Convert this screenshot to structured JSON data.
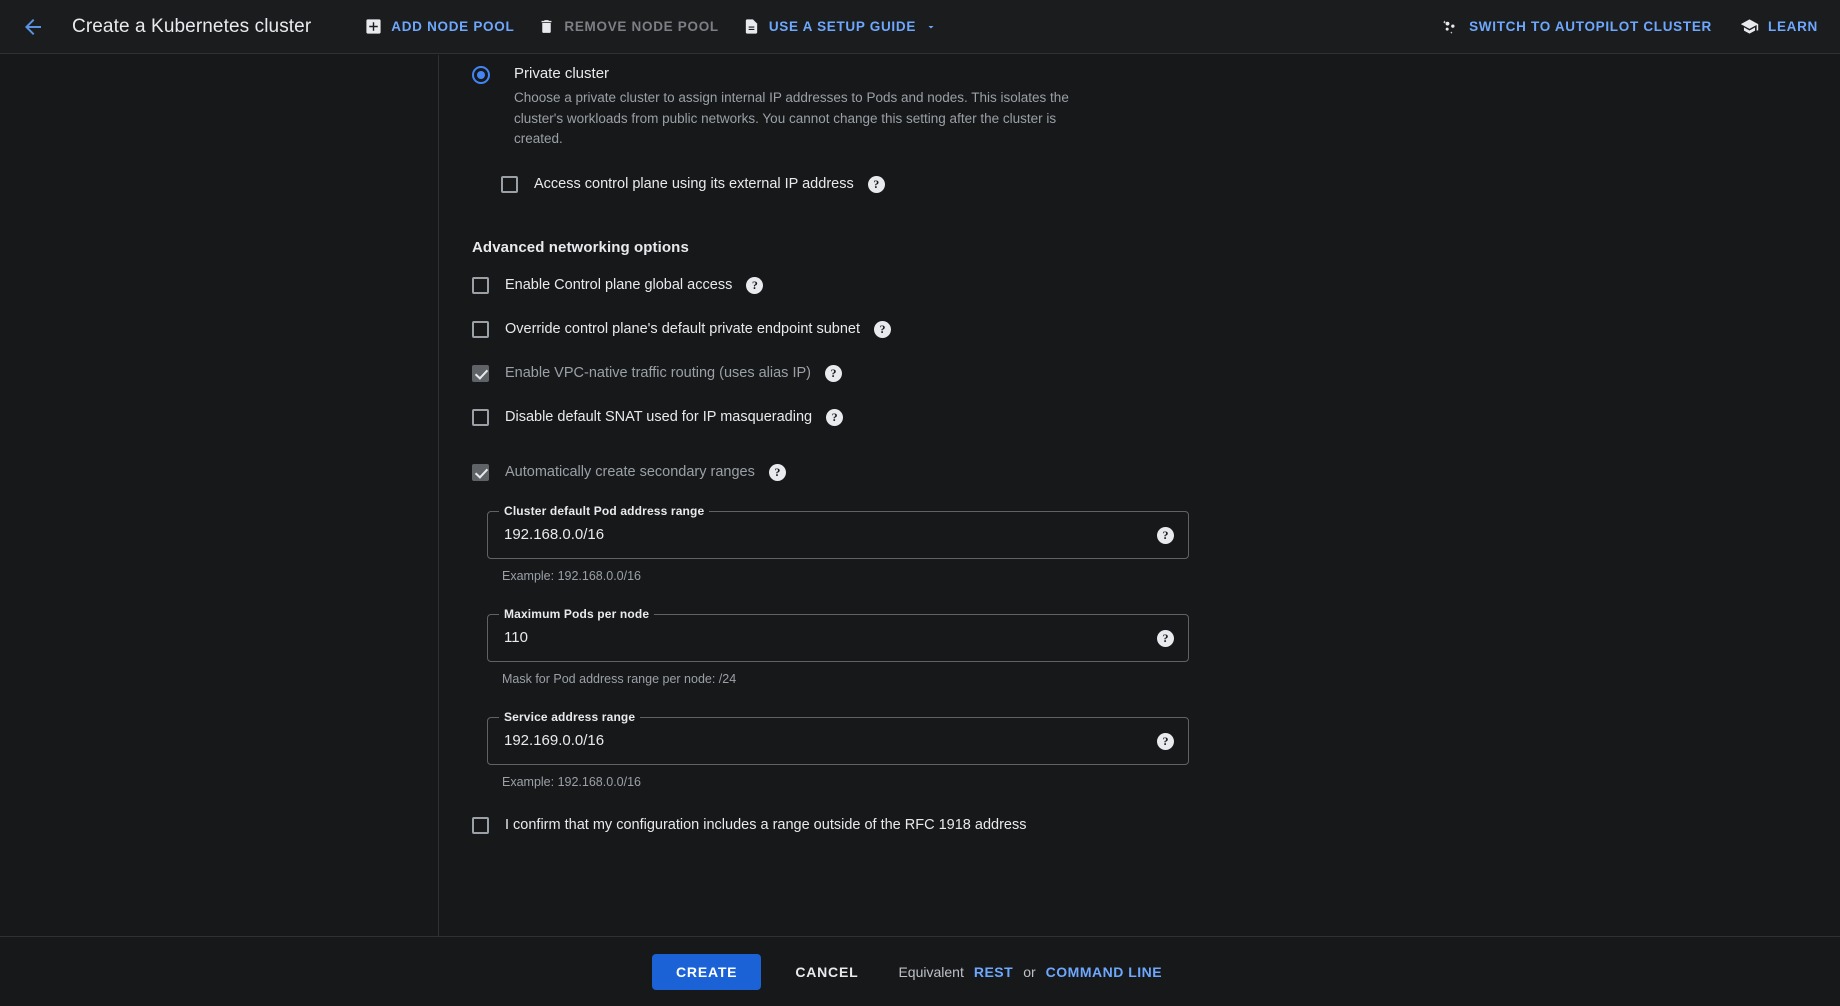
{
  "header": {
    "back_icon": "arrow-left-icon",
    "title": "Create a Kubernetes cluster",
    "actions": [
      {
        "id": "add-node-pool",
        "icon": "plus-box-icon",
        "label": "ADD NODE POOL",
        "enabled": true
      },
      {
        "id": "remove-node-pool",
        "icon": "trash-icon",
        "label": "REMOVE NODE POOL",
        "enabled": false
      },
      {
        "id": "use-a-setup-guide",
        "icon": "document-icon",
        "label": "USE A SETUP GUIDE",
        "enabled": true,
        "has_caret": true
      }
    ],
    "right_actions": [
      {
        "id": "switch-to-autopilot-cluster",
        "icon": "sparkle-icon",
        "label": "SWITCH TO AUTOPILOT CLUSTER"
      },
      {
        "id": "learn",
        "icon": "school-icon",
        "label": "LEARN"
      }
    ]
  },
  "colors": {
    "page_bg": "#17181a",
    "header_bg": "#1b1c1e",
    "accent_link": "#6ea8fe",
    "primary_button": "#1a62d6",
    "radio_checked": "#4285f4",
    "divider": "#2e3033",
    "text_primary": "#e8eaed",
    "text_secondary": "#9aa0a6"
  },
  "main": {
    "cluster_mode": {
      "label": "Private cluster",
      "description": "Choose a private cluster to assign internal IP addresses to Pods and nodes. This isolates the cluster's workloads from public networks. You cannot change this setting after the cluster is created.",
      "selected": true
    },
    "external_ip_checkbox": {
      "label": "Access control plane using its external IP address",
      "checked": false,
      "help": "?"
    },
    "advanced_section_title": "Advanced networking options",
    "advanced_checkboxes": [
      {
        "id": "enable-control-plane-global-access",
        "label": "Enable Control plane global access",
        "checked": false,
        "disabled": false,
        "help": "?"
      },
      {
        "id": "override-control-plane-default-private-endpoint-subnet",
        "label": "Override control plane's default private endpoint subnet",
        "checked": false,
        "disabled": false,
        "help": "?"
      },
      {
        "id": "enable-vpc-native-traffic-routing",
        "label": "Enable VPC-native traffic routing (uses alias IP)",
        "checked": true,
        "disabled": true,
        "help": "?"
      },
      {
        "id": "disable-default-snat",
        "label": "Disable default SNAT used for IP masquerading",
        "checked": false,
        "disabled": false,
        "help": "?"
      },
      {
        "id": "automatically-create-secondary-ranges",
        "label": "Automatically create secondary ranges",
        "checked": true,
        "disabled": true,
        "help": "?"
      }
    ],
    "fields": [
      {
        "id": "cluster-default-pod-address-range",
        "label": "Cluster default Pod address range",
        "value": "192.168.0.0/16",
        "placeholder": "",
        "hint": "Example: 192.168.0.0/16",
        "help": "?"
      },
      {
        "id": "maximum-pods-per-node",
        "label": "Maximum Pods per node",
        "value": "110",
        "placeholder": "",
        "hint": "Mask for Pod address range per node: /24",
        "help": "?"
      },
      {
        "id": "service-address-range",
        "label": "Service address range",
        "value": "192.169.0.0/16",
        "placeholder": "",
        "hint": "Example: 192.168.0.0/16",
        "help": "?"
      }
    ],
    "confirm_checkbox": {
      "label": "I confirm that my configuration includes a range outside of the RFC 1918 address",
      "checked": false
    }
  },
  "bottom_bar": {
    "create_label": "CREATE",
    "cancel_label": "CANCEL",
    "equivalent_label": "Equivalent",
    "rest_label": "REST",
    "or_label": "or",
    "command_line_label": "COMMAND LINE"
  }
}
